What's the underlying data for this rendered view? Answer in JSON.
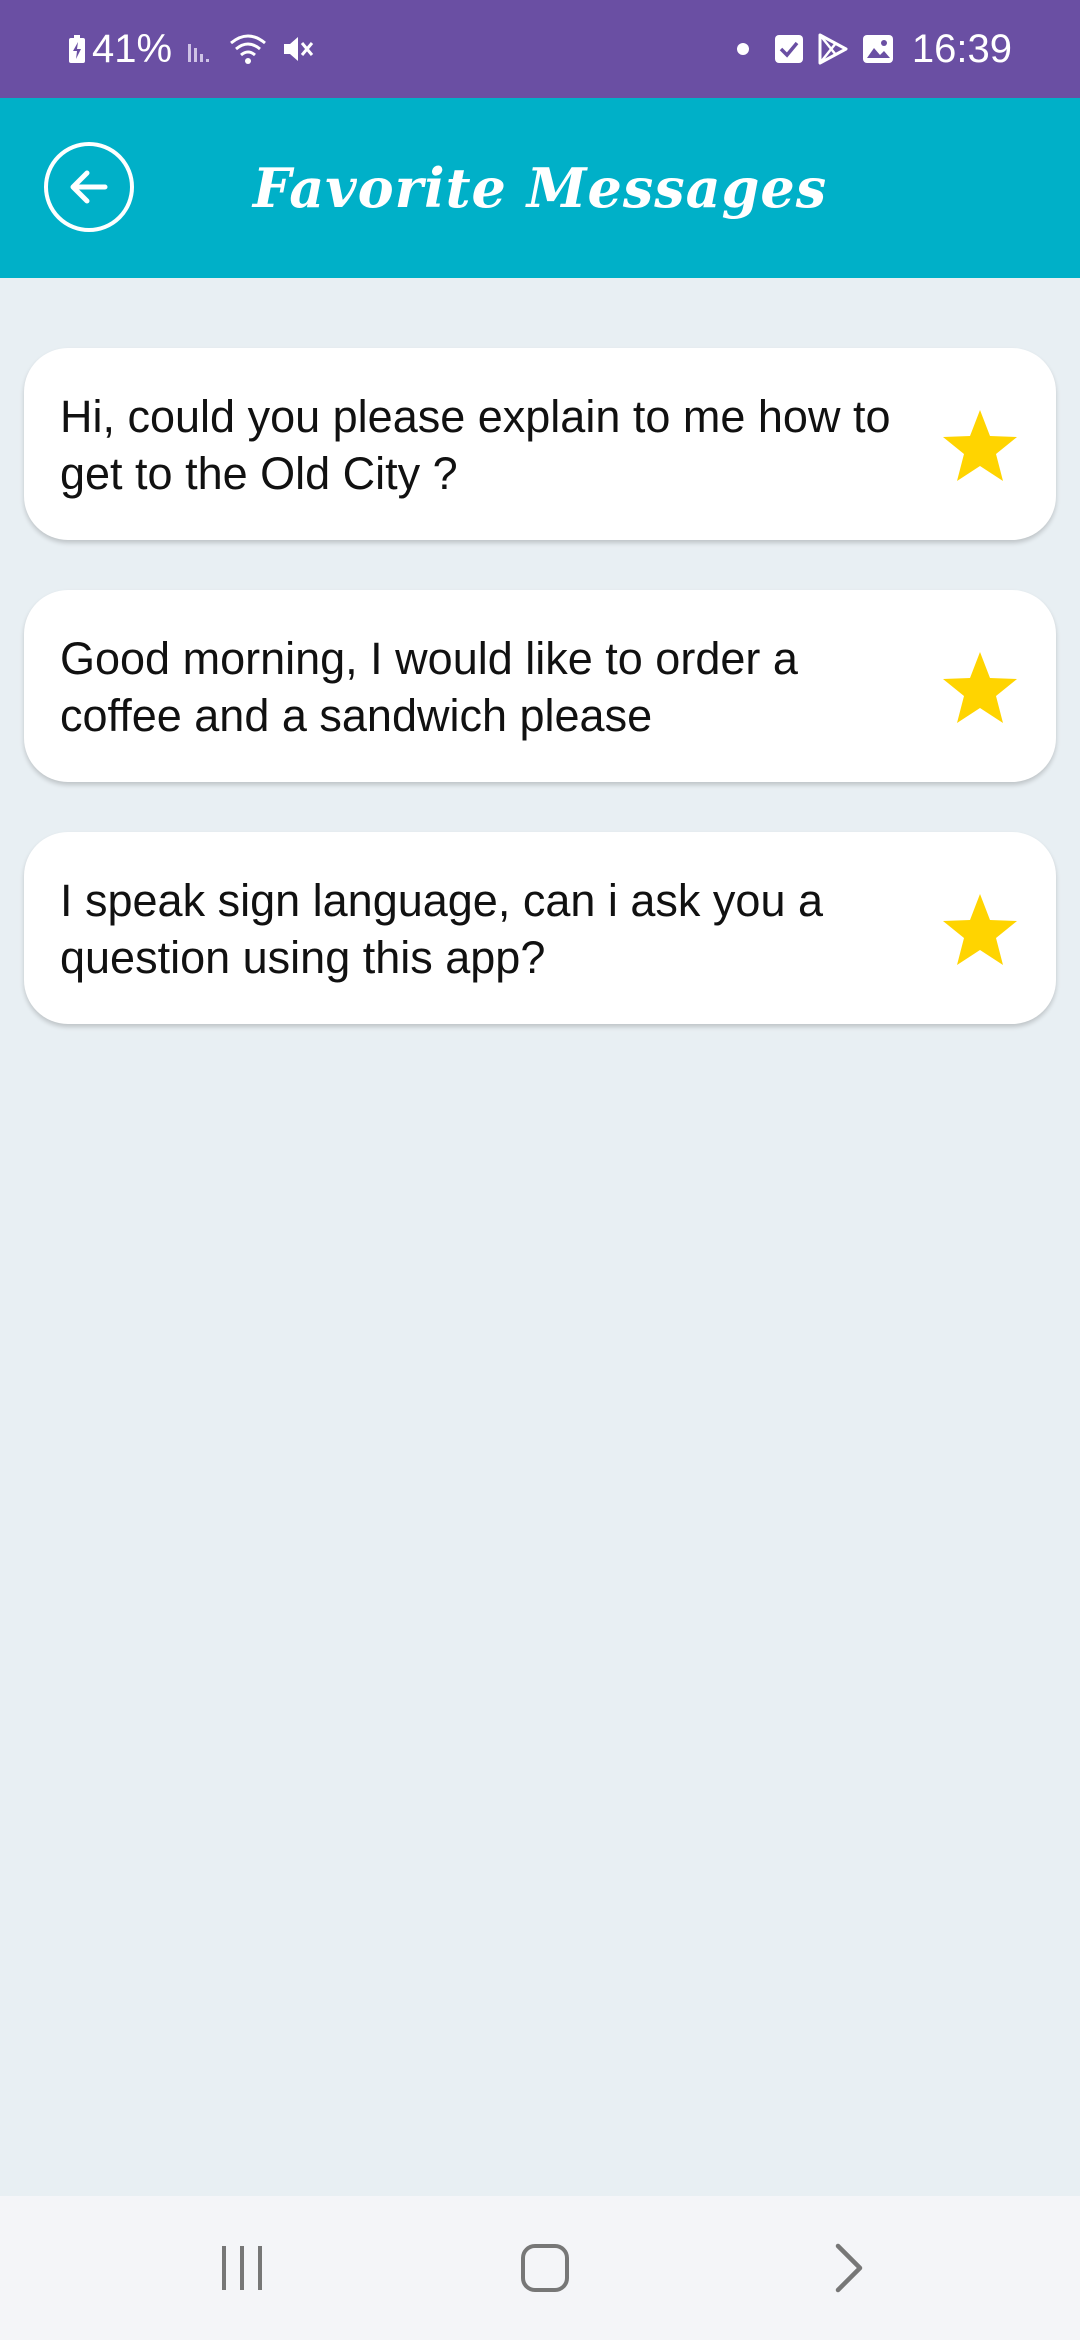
{
  "status_bar": {
    "battery": "41%",
    "time": "16:39",
    "left_icons": [
      "battery-icon",
      "signal-icon",
      "wifi-icon",
      "mute-icon"
    ],
    "right_icons": [
      "dot-icon",
      "checkbox-icon",
      "play-store-icon",
      "gallery-icon"
    ]
  },
  "app_bar": {
    "title": "Favorite Messages",
    "back_icon": "arrow-left-circle-icon",
    "color": "#00b0c8"
  },
  "messages": [
    {
      "text": "Hi, could you please explain to me how to get to the Old City ?",
      "favorite": true
    },
    {
      "text": "Good morning, I would like to order a coffee and a sandwich please",
      "favorite": true
    },
    {
      "text": "I speak sign language, can i ask you a question using this app?",
      "favorite": true
    }
  ],
  "colors": {
    "status_bar": "#6a4fa3",
    "background": "#e8eff3",
    "star": "#ffd400"
  },
  "nav_bar": {
    "buttons": [
      "recents-icon",
      "home-icon",
      "back-chevron-icon"
    ]
  }
}
